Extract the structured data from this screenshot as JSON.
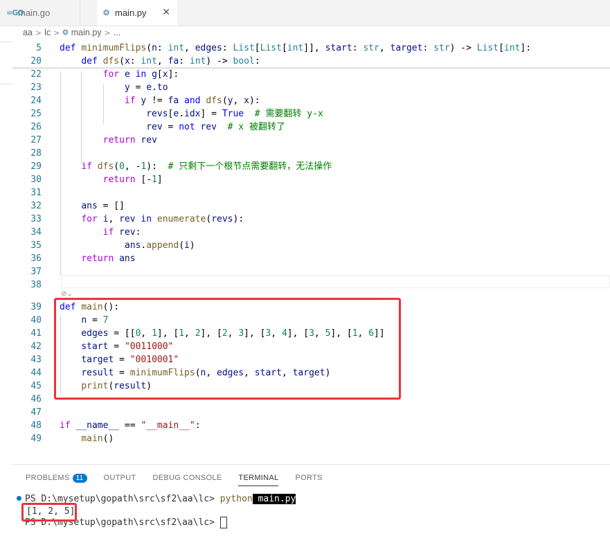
{
  "tabs": [
    {
      "label": "main.go",
      "icon": "go-file-icon"
    },
    {
      "label": "main.py",
      "icon": "python-file-icon"
    }
  ],
  "breadcrumb": {
    "items": [
      "aa",
      "lc",
      "main.py",
      "..."
    ]
  },
  "editor": {
    "sticky": [
      {
        "num": "5",
        "code": "def minimumFlips(n: int, edges: List[List[int]], start: str, target: str) -> List[int]:"
      },
      {
        "num": "20",
        "code": "    def dfs(x: int, fa: int) -> bool:"
      }
    ],
    "lines": [
      {
        "num": "22",
        "code": "        for e in g[x]:"
      },
      {
        "num": "23",
        "code": "            y = e.to"
      },
      {
        "num": "24",
        "code": "            if y != fa and dfs(y, x):"
      },
      {
        "num": "25",
        "code": "                revs[e.idx] = True  # 需要翻转 y-x"
      },
      {
        "num": "26",
        "code": "                rev = not rev  # x 被翻转了"
      },
      {
        "num": "27",
        "code": "        return rev"
      },
      {
        "num": "28",
        "code": ""
      },
      {
        "num": "29",
        "code": "    if dfs(0, -1):  # 只剩下一个根节点需要翻转，无法操作"
      },
      {
        "num": "30",
        "code": "        return [-1]"
      },
      {
        "num": "31",
        "code": ""
      },
      {
        "num": "32",
        "code": "    ans = []"
      },
      {
        "num": "33",
        "code": "    for i, rev in enumerate(revs):"
      },
      {
        "num": "34",
        "code": "        if rev:"
      },
      {
        "num": "35",
        "code": "            ans.append(i)"
      },
      {
        "num": "36",
        "code": "    return ans"
      },
      {
        "num": "37",
        "code": ""
      },
      {
        "num": "38",
        "code": ""
      },
      {
        "num": "39",
        "code": "def main():"
      },
      {
        "num": "40",
        "code": "    n = 7"
      },
      {
        "num": "41",
        "code": "    edges = [[0, 1], [1, 2], [2, 3], [3, 4], [3, 5], [1, 6]]"
      },
      {
        "num": "42",
        "code": "    start = \"0011000\""
      },
      {
        "num": "43",
        "code": "    target = \"0010001\""
      },
      {
        "num": "44",
        "code": "    result = minimumFlips(n, edges, start, target)"
      },
      {
        "num": "45",
        "code": "    print(result)"
      },
      {
        "num": "46",
        "code": ""
      },
      {
        "num": "47",
        "code": ""
      },
      {
        "num": "48",
        "code": "if __name__ == \"__main__\":"
      },
      {
        "num": "49",
        "code": "    main()"
      }
    ]
  },
  "panel": {
    "tabs": [
      {
        "label": "PROBLEMS",
        "badge": "11"
      },
      {
        "label": "OUTPUT"
      },
      {
        "label": "DEBUG CONSOLE"
      },
      {
        "label": "TERMINAL",
        "active": true
      },
      {
        "label": "PORTS"
      }
    ]
  },
  "terminal": {
    "prompt1": "PS D:\\mysetup\\gopath\\src\\sf2\\aa\\lc> ",
    "command": "python",
    "argument": " main.py",
    "output": "[1, 2, 5]",
    "prompt2": "PS D:\\mysetup\\gopath\\src\\sf2\\aa\\lc> "
  },
  "colors": {
    "highlight_border": "#e8343b",
    "keyword": "#0000ff",
    "control": "#af00db",
    "function": "#795e26",
    "type": "#267f99",
    "string": "#a31515",
    "number": "#098658",
    "comment": "#008000",
    "line_number": "#237893",
    "badge": "#007acc"
  }
}
